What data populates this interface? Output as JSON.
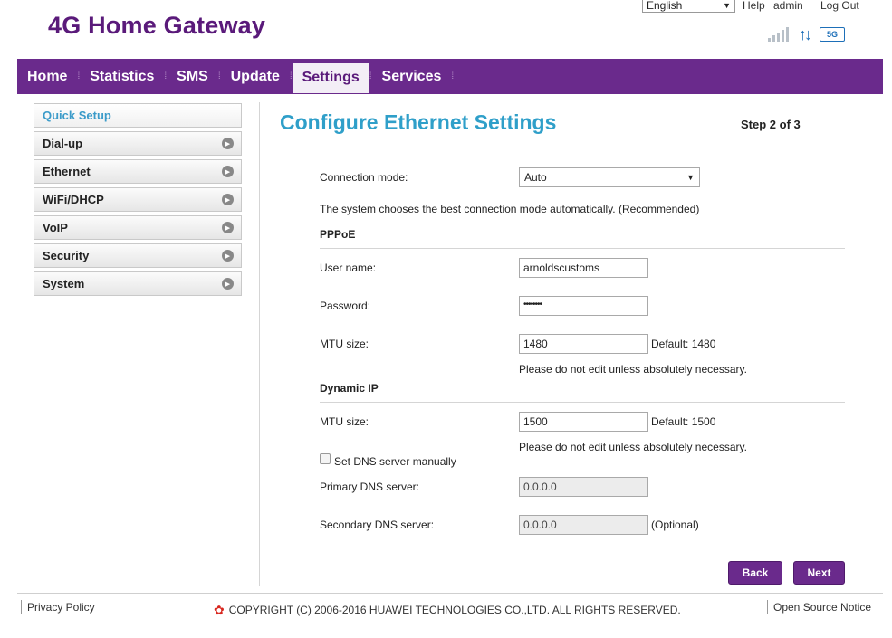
{
  "header": {
    "brand": "4G Home Gateway",
    "language": "English",
    "help": "Help",
    "user": "admin",
    "logout": "Log Out",
    "network_badge": "5G"
  },
  "nav": {
    "items": [
      {
        "label": "Home"
      },
      {
        "label": "Statistics"
      },
      {
        "label": "SMS"
      },
      {
        "label": "Update"
      },
      {
        "label": "Settings",
        "active": true
      },
      {
        "label": "Services"
      }
    ]
  },
  "sidebar": {
    "items": [
      {
        "label": "Quick Setup",
        "active": true
      },
      {
        "label": "Dial-up"
      },
      {
        "label": "Ethernet"
      },
      {
        "label": "WiFi/DHCP"
      },
      {
        "label": "VoIP"
      },
      {
        "label": "Security"
      },
      {
        "label": "System"
      }
    ]
  },
  "main": {
    "title": "Configure Ethernet Settings",
    "step": "Step 2 of 3",
    "connection_mode_label": "Connection mode:",
    "connection_mode_value": "Auto",
    "connection_mode_desc": "The system chooses the best connection mode automatically. (Recommended)",
    "pppoe": {
      "heading": "PPPoE",
      "username_label": "User name:",
      "username_value": "arnoldscustoms",
      "password_label": "Password:",
      "password_value": "••••••••",
      "mtu_label": "MTU size:",
      "mtu_value": "1480",
      "mtu_default": "Default: 1480",
      "mtu_note": "Please do not edit unless absolutely necessary."
    },
    "dynamic_ip": {
      "heading": "Dynamic IP",
      "mtu_label": "MTU size:",
      "mtu_value": "1500",
      "mtu_default": "Default: 1500",
      "mtu_note": "Please do not edit unless absolutely necessary.",
      "dns_manual_label": "Set DNS server manually",
      "dns_manual_checked": false,
      "primary_dns_label": "Primary DNS server:",
      "primary_dns_value": "0.0.0.0",
      "secondary_dns_label": "Secondary DNS server:",
      "secondary_dns_value": "0.0.0.0",
      "secondary_dns_optional": "(Optional)"
    },
    "back_label": "Back",
    "next_label": "Next"
  },
  "footer": {
    "privacy": "Privacy Policy",
    "copyright": "COPYRIGHT (C) 2006-2016 HUAWEI TECHNOLOGIES CO.,LTD. ALL RIGHTS RESERVED.",
    "open_source": "Open Source Notice"
  },
  "colors": {
    "brand_purple": "#6a2a8c",
    "title_blue": "#2f9fc9"
  }
}
